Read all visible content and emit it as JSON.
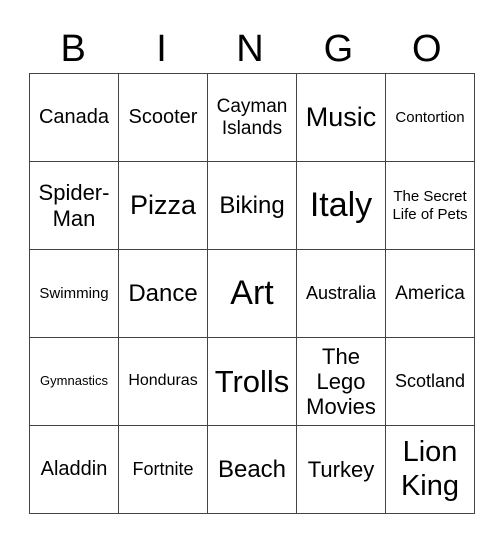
{
  "header": {
    "letters": [
      "B",
      "I",
      "N",
      "G",
      "O"
    ]
  },
  "grid": {
    "rows": [
      [
        "Canada",
        "Scooter",
        "Cayman Islands",
        "Music",
        "Contortion"
      ],
      [
        "Spider-Man",
        "Pizza",
        "Biking",
        "Italy",
        "The Secret Life of Pets"
      ],
      [
        "Swimming",
        "Dance",
        "Art",
        "Australia",
        "America"
      ],
      [
        "Gymnastics",
        "Honduras",
        "Trolls",
        "The Lego Movies",
        "Scotland"
      ],
      [
        "Aladdin",
        "Fortnite",
        "Beach",
        "Turkey",
        "Lion King"
      ]
    ]
  }
}
